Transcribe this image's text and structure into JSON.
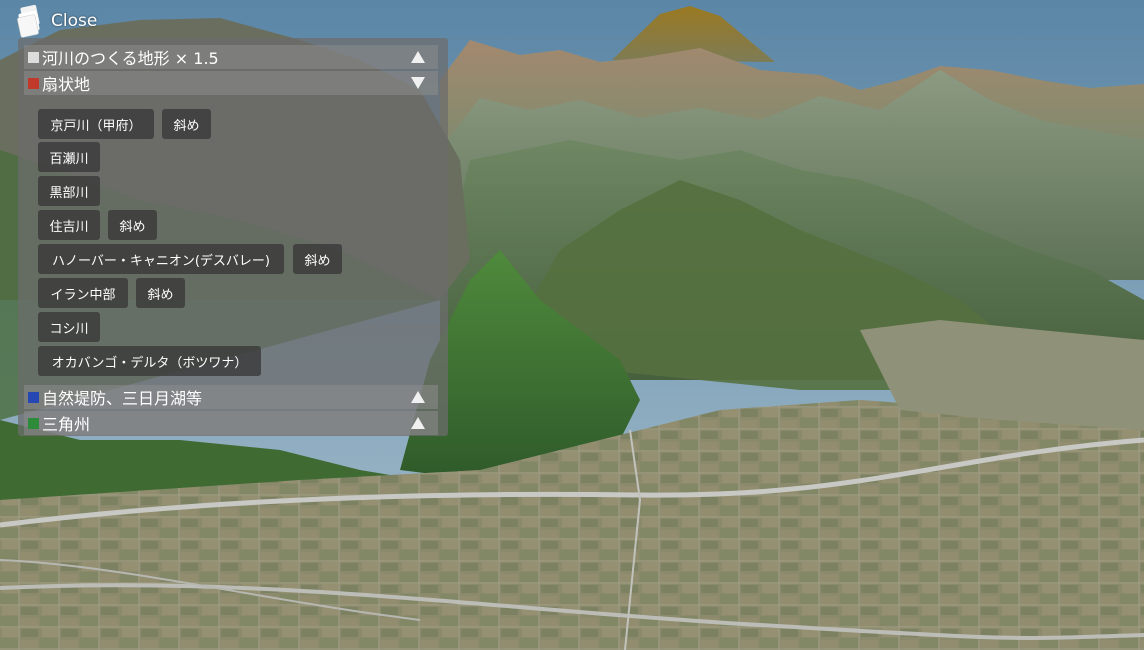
{
  "close": {
    "label": "Close",
    "icon": "layers-stack-icon"
  },
  "categories": [
    {
      "label": "河川のつくる地形 × 1.5",
      "color": "#dddddd",
      "arrow": "up"
    },
    {
      "label": "扇状地",
      "color": "#c0392b",
      "arrow": "down"
    },
    {
      "label": "自然堤防、三日月湖等",
      "color": "#2747b5",
      "arrow": "up"
    },
    {
      "label": "三角州",
      "color": "#2e8b3a",
      "arrow": "up"
    }
  ],
  "fan_items": [
    {
      "label": "京戸川（甲府）",
      "oblique": "斜め"
    },
    {
      "label": "百瀬川"
    },
    {
      "label": "黒部川"
    },
    {
      "label": "住吉川",
      "oblique": "斜め"
    },
    {
      "label": "ハノーバー・キャニオン(デスバレー)",
      "oblique": "斜め"
    },
    {
      "label": "イラン中部",
      "oblique": "斜め"
    },
    {
      "label": "コシ川"
    },
    {
      "label": "オカバンゴ・デルタ（ボツワナ）"
    }
  ],
  "colors": {
    "panel_bg": "rgba(108,108,108,0.74)",
    "chip_bg": "rgba(58,58,58,0.82)",
    "sky_top": "#5f8aa8",
    "sky_bottom": "#a9c1cf"
  }
}
